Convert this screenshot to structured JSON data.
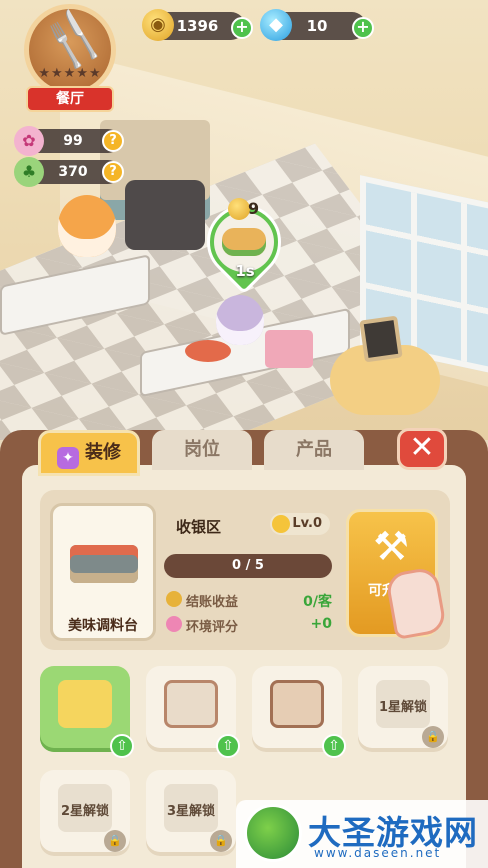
{
  "hud": {
    "restaurant_label": "餐厅",
    "stars": "★★★★★",
    "coins": "1396",
    "gems": "10",
    "flower_points": "99",
    "clover_points": "370"
  },
  "order_bubble": {
    "coin_count": "9",
    "timer": "1s"
  },
  "tabs": [
    {
      "label": "装修"
    },
    {
      "label": "岗位"
    },
    {
      "label": "产品"
    }
  ],
  "station": {
    "item_name": "美味调料台",
    "name": "收银区",
    "level": "Lv.0",
    "progress_text": "0 / 5",
    "progress": 0,
    "checkout_label": "结账收益",
    "checkout_value": "0/客",
    "env_label": "环境评分",
    "env_value": "+0",
    "upgrade_label": "可升"
  },
  "slots": [
    {
      "name": "cash-register",
      "selected": true,
      "locked": false,
      "label": ""
    },
    {
      "name": "stove",
      "selected": false,
      "locked": false,
      "label": ""
    },
    {
      "name": "chair",
      "selected": false,
      "locked": false,
      "label": ""
    },
    {
      "name": "locked-1",
      "selected": false,
      "locked": true,
      "label": "1星解锁"
    },
    {
      "name": "locked-2",
      "selected": false,
      "locked": true,
      "label": "2星解锁"
    },
    {
      "name": "locked-3",
      "selected": false,
      "locked": true,
      "label": "3星解锁"
    }
  ],
  "watermark": {
    "title": "大圣游戏网",
    "url": "www.daseen.net"
  },
  "colors": {
    "panel_brown": "#8b5c42",
    "tab_gold": "#f7c24a",
    "close_red": "#e04a3c",
    "plus_green": "#4fc24c",
    "selected_slot_green": "#9bd874"
  }
}
